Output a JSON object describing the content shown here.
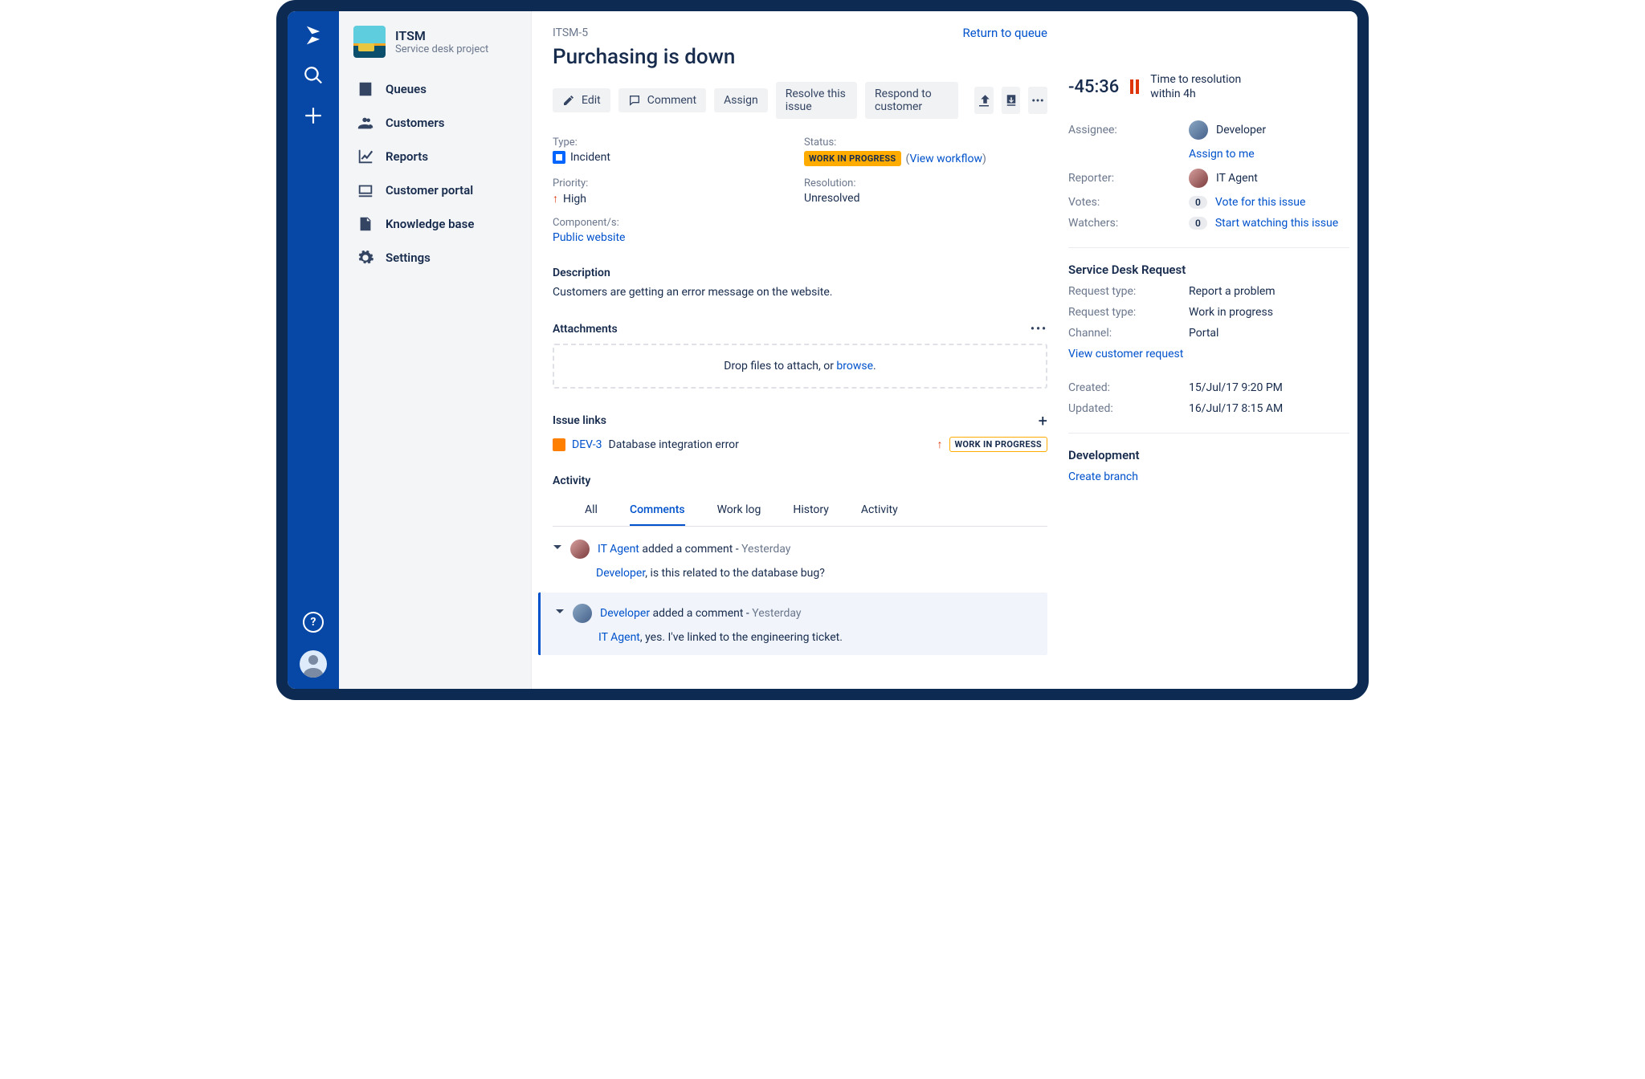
{
  "project": {
    "name": "ITSM",
    "subtitle": "Service desk project"
  },
  "nav": {
    "items": [
      "Queues",
      "Customers",
      "Reports",
      "Customer portal",
      "Knowledge base",
      "Settings"
    ]
  },
  "breadcrumb": "ITSM-5",
  "return_link": "Return to queue",
  "title": "Purchasing is down",
  "actions": {
    "edit": "Edit",
    "comment": "Comment",
    "assign": "Assign",
    "resolve": "Resolve this issue",
    "respond": "Respond to customer"
  },
  "meta": {
    "type_label": "Type:",
    "type_value": "Incident",
    "status_label": "Status:",
    "status_value": "WORK IN PROGRESS",
    "view_workflow": "View workflow",
    "priority_label": "Priority:",
    "priority_value": "High",
    "resolution_label": "Resolution:",
    "resolution_value": "Unresolved",
    "components_label": "Component/s:",
    "components_value": "Public website"
  },
  "description": {
    "heading": "Description",
    "body": "Customers are getting an error message on the website."
  },
  "attachments": {
    "heading": "Attachments",
    "drop_prefix": "Drop files to attach, or ",
    "browse": "browse",
    "drop_suffix": "."
  },
  "issue_links": {
    "heading": "Issue links",
    "key": "DEV-3",
    "summary": "Database integration error",
    "status": "WORK IN PROGRESS"
  },
  "activity": {
    "heading": "Activity",
    "tabs": {
      "all": "All",
      "comments": "Comments",
      "worklog": "Work log",
      "history": "History",
      "activity": "Activity"
    },
    "c1": {
      "user": "IT Agent",
      "rest": " added a comment - ",
      "time": "Yesterday",
      "mention": "Developer",
      "body_rest": ", is this related to the database bug?"
    },
    "c2": {
      "user": "Developer",
      "rest": " added a comment - ",
      "time": "Yesterday",
      "mention": "IT Agent",
      "body_rest": ", yes. I've linked to the engineering ticket."
    }
  },
  "sla": {
    "time": "-45:36",
    "line1": "Time to resolution",
    "line2": "within 4h"
  },
  "people": {
    "assignee_label": "Assignee:",
    "assignee": "Developer",
    "assign_to_me": "Assign to me",
    "reporter_label": "Reporter:",
    "reporter": "IT Agent",
    "votes_label": "Votes:",
    "votes_count": "0",
    "vote_action": "Vote for this issue",
    "watchers_label": "Watchers:",
    "watchers_count": "0",
    "watch_action": "Start watching this issue"
  },
  "sdr": {
    "heading": "Service Desk Request",
    "req_type_label": "Request type:",
    "req_type": "Report a problem",
    "req_status_label": "Request type:",
    "req_status": "Work in progress",
    "channel_label": "Channel:",
    "channel": "Portal",
    "view_request": "View customer request"
  },
  "dates": {
    "created_label": "Created:",
    "created": "15/Jul/17 9:20 PM",
    "updated_label": "Updated:",
    "updated": "16/Jul/17 8:15 AM"
  },
  "dev": {
    "heading": "Development",
    "create_branch": "Create branch"
  }
}
